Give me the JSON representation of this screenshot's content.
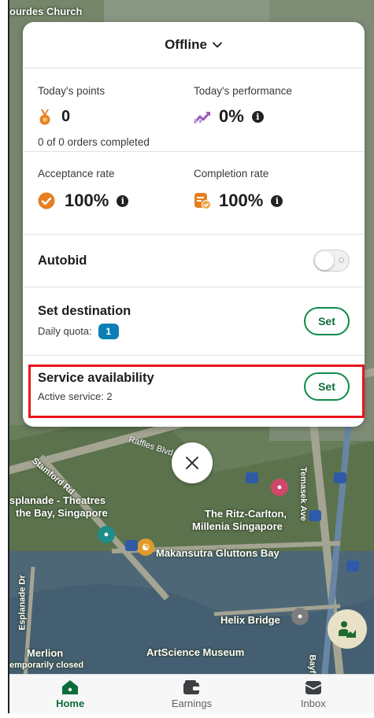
{
  "map": {
    "labels": {
      "church": "ourdes Church",
      "theatres_line1": "splanade - Theatres",
      "theatres_line2": "the Bay, Singapore",
      "ritz_line1": "The Ritz-Carlton,",
      "ritz_line2": "Millenia Singapore",
      "makansutra": "Makansutra Gluttons Bay",
      "helix": "Helix Bridge",
      "merlion": "Merlion",
      "merlion_status": "emporarily closed",
      "artscience": "ArtScience Museum",
      "raffles": "Raffles Blvd",
      "stamford": "Stamford Rd",
      "temasek": "Temasek Ave",
      "esplanade_dr": "Esplanade Dr",
      "bayfront": "Bayfr"
    }
  },
  "header": {
    "status": "Offline"
  },
  "stats": {
    "points": {
      "label": "Today's points",
      "value": "0",
      "sub": "0 of 0 orders completed"
    },
    "performance": {
      "label": "Today's performance",
      "value": "0%"
    },
    "acceptance": {
      "label": "Acceptance rate",
      "value": "100%"
    },
    "completion": {
      "label": "Completion rate",
      "value": "100%"
    }
  },
  "autobid": {
    "label": "Autobid",
    "enabled": false
  },
  "destination": {
    "title": "Set destination",
    "sub_label": "Daily quota:",
    "quota": "1",
    "button": "Set"
  },
  "service": {
    "title": "Service availability",
    "sub": "Active service: 2",
    "button": "Set"
  },
  "nav": {
    "items": [
      {
        "label": "Home",
        "icon": "home-icon",
        "active": true
      },
      {
        "label": "Earnings",
        "icon": "wallet-icon",
        "active": false
      },
      {
        "label": "Inbox",
        "icon": "inbox-icon",
        "active": false
      }
    ]
  },
  "colors": {
    "accent": "#0d8a4a",
    "highlight": "#e8141e",
    "badge": "#0b7fb5"
  }
}
